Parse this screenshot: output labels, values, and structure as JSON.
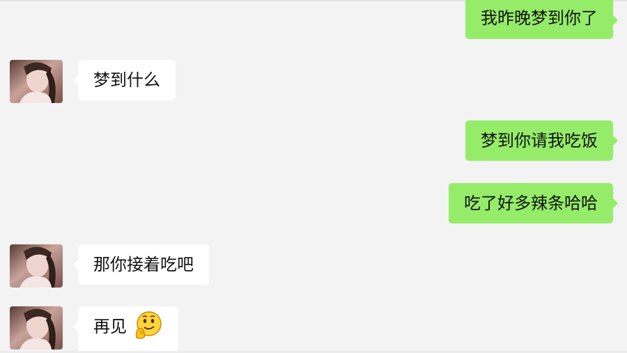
{
  "chat": {
    "messages": [
      {
        "side": "right",
        "text": "我昨晚梦到你了"
      },
      {
        "side": "left",
        "text": "梦到什么"
      },
      {
        "side": "right",
        "text": "梦到你请我吃饭"
      },
      {
        "side": "right",
        "text": "吃了好多辣条哈哈"
      },
      {
        "side": "left",
        "text": "那你接着吃吧"
      },
      {
        "side": "left",
        "text": "再见",
        "emoji": "thinking-smile-emoji"
      }
    ]
  },
  "colors": {
    "background": "#f3f3f3",
    "sent_bubble": "#95ec69",
    "received_bubble": "#ffffff",
    "text": "#111111"
  }
}
